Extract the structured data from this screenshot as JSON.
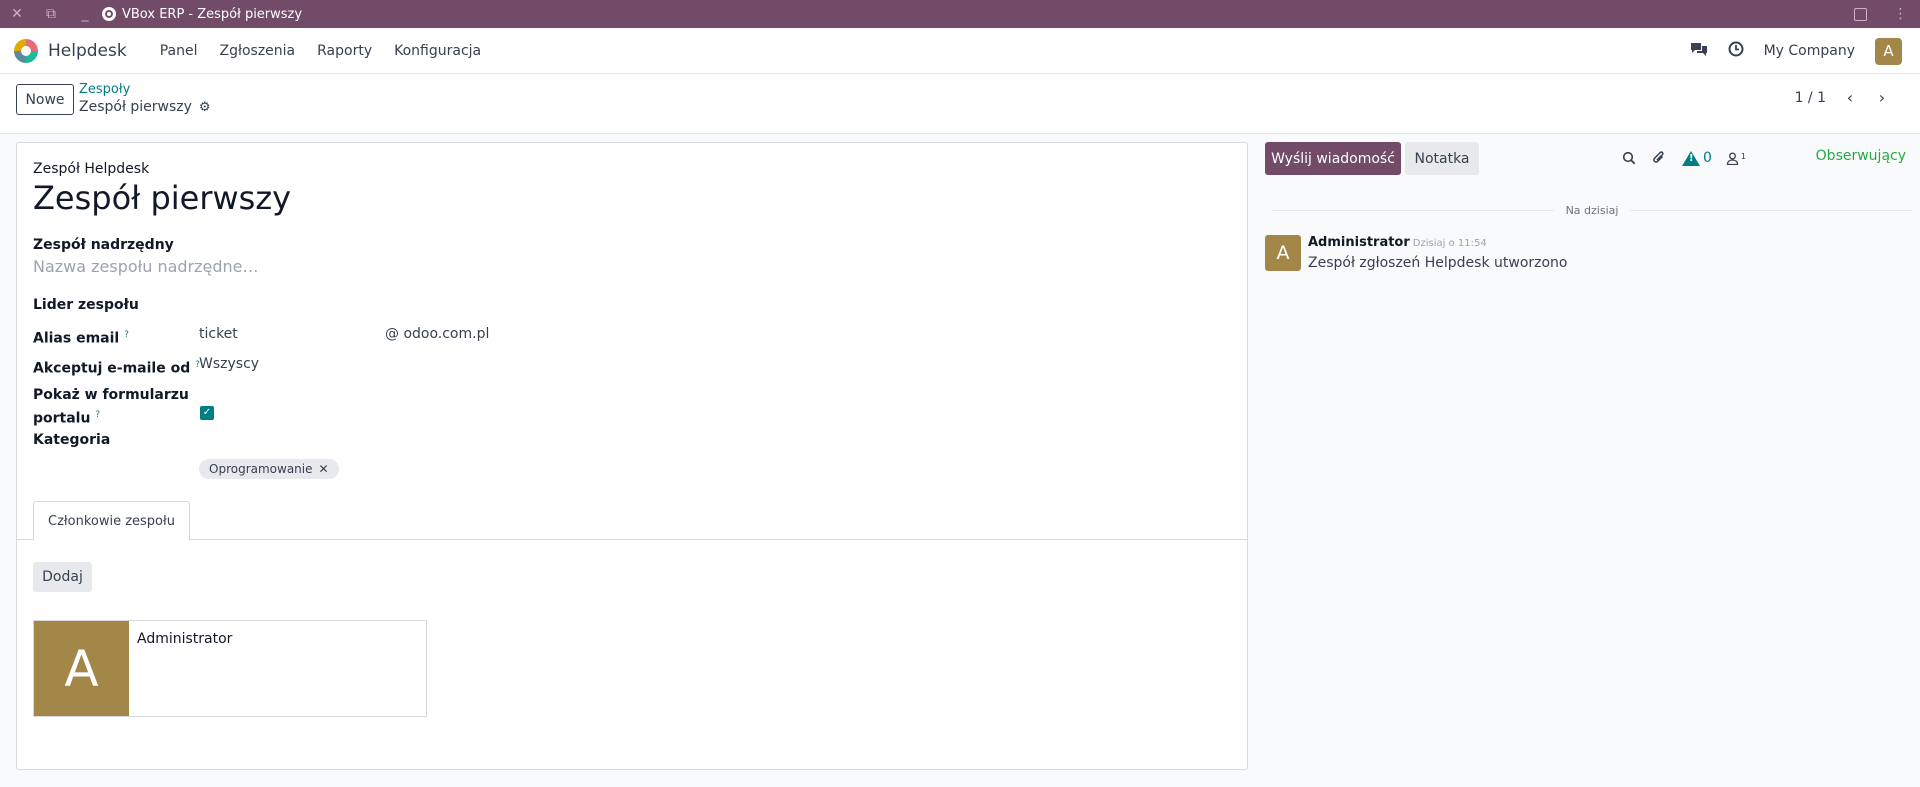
{
  "window": {
    "title": "VBox ERP - Zespół pierwszy"
  },
  "navbar": {
    "app_name": "Helpdesk",
    "menu": [
      "Panel",
      "Zgłoszenia",
      "Raporty",
      "Konfiguracja"
    ],
    "company": "My Company",
    "avatar_letter": "A"
  },
  "control_panel": {
    "new_button": "Nowe",
    "breadcrumb_parent": "Zespoły",
    "breadcrumb_current": "Zespół pierwszy",
    "pager": "1 / 1"
  },
  "form": {
    "header_label": "Zespół Helpdesk",
    "name": "Zespół pierwszy",
    "parent_label": "Zespół nadrzędny",
    "parent_placeholder": "Nazwa zespołu nadrzędne…",
    "leader_label": "Lider zespołu",
    "alias_label": "Alias email",
    "alias_value": "ticket",
    "alias_domain": "@ odoo.com.pl",
    "accept_label": "Akceptuj e-maile od",
    "accept_value": "Wszyscy",
    "portal_label_1": "Pokaż w formularzu",
    "portal_label_2": "portalu",
    "portal_checked": true,
    "category_label": "Kategoria",
    "category_tag": "Oprogramowanie",
    "help_mark": "?",
    "tab_members": "Członkowie zespołu",
    "add_button": "Dodaj",
    "members": [
      {
        "initial": "A",
        "name": "Administrator"
      }
    ]
  },
  "chatter": {
    "send_button": "Wyślij wiadomość",
    "note_button": "Notatka",
    "activity_count": "0",
    "follower_count": "1",
    "follow_button": "Obserwujący",
    "day_separator": "Na dzisiaj",
    "messages": [
      {
        "initial": "A",
        "author": "Administrator",
        "date": "Dzisiaj o 11:54",
        "body": "Zespół zgłoszeń Helpdesk utworzono"
      }
    ]
  },
  "colors": {
    "brand": "#714b67",
    "accent": "#017e84",
    "avatar": "#a28748",
    "follow": "#28a745"
  }
}
